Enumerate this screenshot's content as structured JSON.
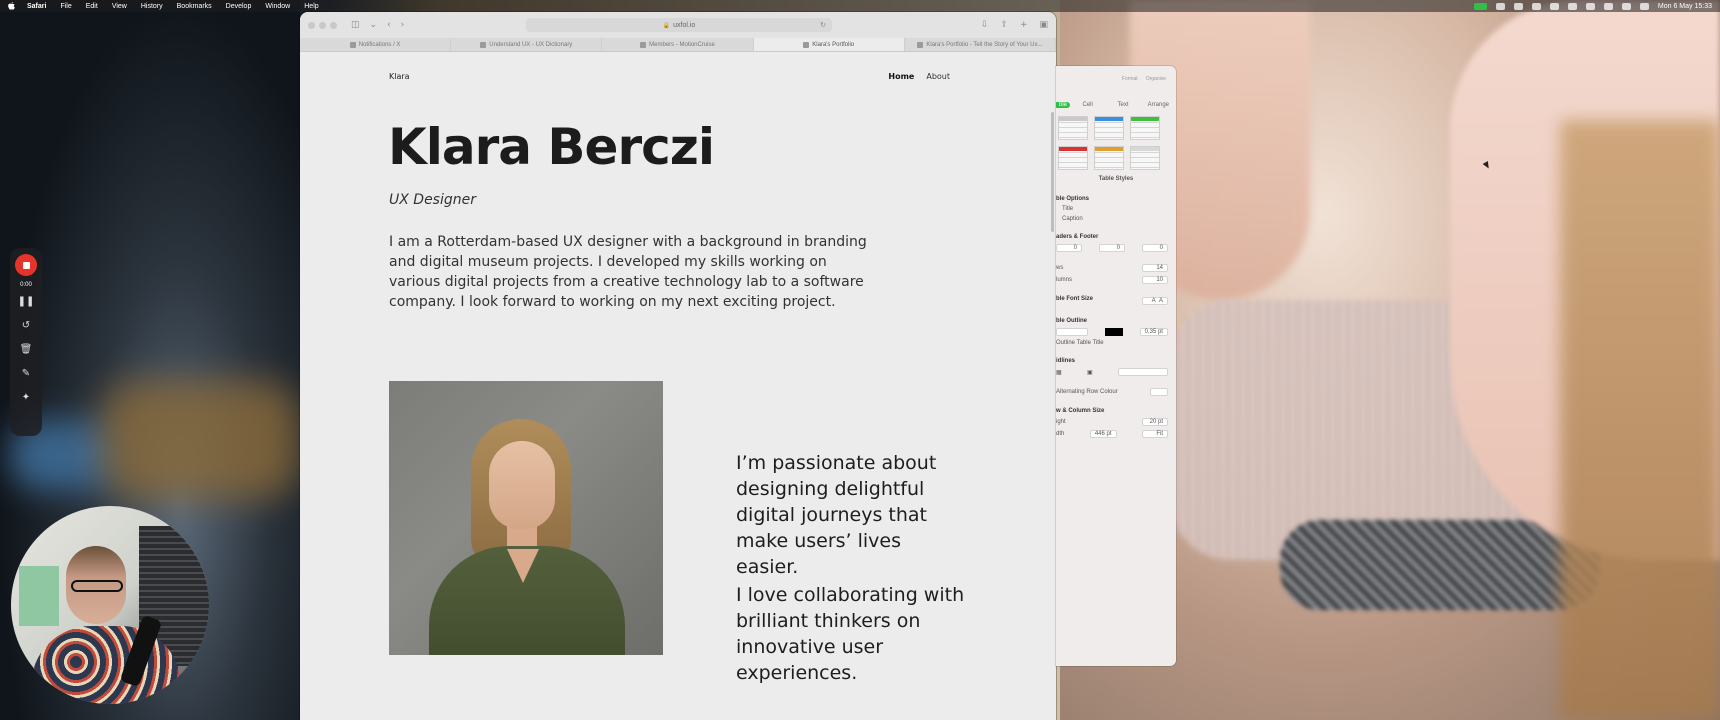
{
  "menubar": {
    "items": [
      "Safari",
      "File",
      "Edit",
      "View",
      "History",
      "Bookmarks",
      "Develop",
      "Window",
      "Help"
    ],
    "clock": "Mon 6 May 15:33"
  },
  "browser": {
    "url": "uxfol.io",
    "tabs": [
      "Notifications / X",
      "Understand UX - UX Dictionary",
      "Members - MotionCruise",
      "Klara's Portfolio",
      "Klara's Portfolio - Tell the Story of Your Ux..."
    ],
    "active_tab_index": 2
  },
  "site": {
    "brand": "Klara",
    "nav": [
      "Home",
      "About"
    ],
    "name": "Klara Berczi",
    "role": "UX Designer",
    "bio": "I am a Rotterdam-based UX designer with a background in branding and digital museum projects. I developed my skills working on various digital projects from a creative technology lab to a software company. I look forward to working on my next exciting project.",
    "quote1": "I’m passionate about designing delightful digital journeys that make users’ lives easier.",
    "quote2": "I love collaborating with brilliant thinkers on innovative user experiences."
  },
  "inspector": {
    "toolbar": [
      "Format",
      "Organise"
    ],
    "tabs": [
      "ble",
      "Cell",
      "Text",
      "Arrange"
    ],
    "swatch_colors": [
      "#c9c9c9",
      "#3a8fdc",
      "#3fbf3f",
      "#d63333",
      "#e0a030",
      "#d8d8d8"
    ],
    "table_styles_label": "Table Styles",
    "table_options": {
      "title": "ble Options",
      "items": [
        "Title",
        "Caption"
      ]
    },
    "headers_footer": {
      "title": "aders & Footer",
      "values": [
        "0",
        "0",
        "0"
      ]
    },
    "rows": {
      "label": "ws",
      "value": "14"
    },
    "columns": {
      "label": "lumns",
      "value": "10"
    },
    "font_size": {
      "label": "ble Font Size",
      "a_small": "A",
      "a_large": "A"
    },
    "outline": {
      "title": "ble Outline",
      "width": "0,35 pt",
      "check": "Outline Table Title"
    },
    "gridlines": {
      "title": "idlines"
    },
    "alternating": "Alternating Row Colour",
    "size": {
      "title": "w & Column Size",
      "height_label": "ight",
      "height": "20 pt",
      "width_label": "dth",
      "width": "446 pt",
      "fit": "Fit"
    }
  },
  "recorder": {
    "time": "0:00"
  }
}
